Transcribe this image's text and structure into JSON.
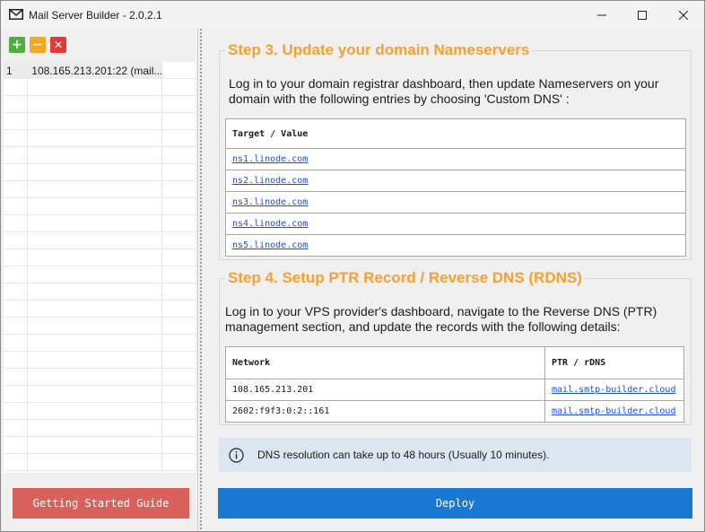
{
  "window": {
    "title": "Mail Server Builder - 2.0.2.1"
  },
  "toolbar": {
    "add_icon": "plus-icon",
    "remove_icon": "minus-icon",
    "delete_icon": "close-icon",
    "colors": {
      "add": "#4caf3e",
      "remove": "#f5a623",
      "delete": "#e53935"
    }
  },
  "servers": [
    {
      "index": "1",
      "host": "108.165.213.201:22 (mail...."
    }
  ],
  "left": {
    "guide_label": "Getting Started Guide"
  },
  "step3": {
    "title": "Step 3. Update your domain Nameservers",
    "description": "Log in to your domain registrar dashboard, then update Nameservers on your domain with the following entries by choosing 'Custom DNS' :",
    "header": "Target / Value",
    "nameservers": [
      "ns1.linode.com",
      "ns2.linode.com",
      "ns3.linode.com",
      "ns4.linode.com",
      "ns5.linode.com"
    ]
  },
  "step4": {
    "title": "Step 4. Setup PTR Record / Reverse DNS (RDNS)",
    "description": "Log in to your VPS provider's dashboard, navigate to the Reverse DNS (PTR) management section, and update the records with the following details:",
    "headers": {
      "network": "Network",
      "ptr": "PTR / rDNS"
    },
    "rows": [
      {
        "network": "108.165.213.201",
        "ptr": "mail.smtp-builder.cloud"
      },
      {
        "network": "2602:f9f3:0:2::161",
        "ptr": "mail.smtp-builder.cloud"
      }
    ]
  },
  "info": {
    "icon": "info-icon",
    "text": "DNS resolution can take up to 48 hours (Usually 10 minutes)."
  },
  "deploy_label": "Deploy",
  "colors": {
    "accent_orange": "#f5a030",
    "deploy_blue": "#1978d4",
    "guide_red": "#d9615c",
    "link_blue": "#1a4fd6",
    "info_bg": "#dbe6f1"
  }
}
